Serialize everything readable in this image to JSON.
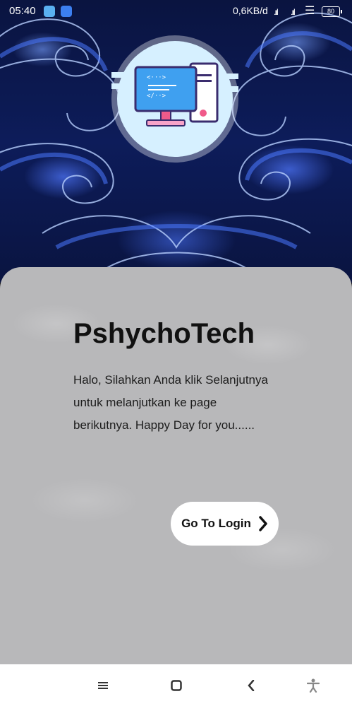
{
  "status_bar": {
    "time": "05:40",
    "network_speed": "0,6KB/d",
    "signal1": ".ııl",
    "signal2": ".ııl",
    "wifi": "wifi-icon",
    "battery": "80"
  },
  "hero": {
    "logo_icon": "computer-desktop-icon"
  },
  "card": {
    "title": "PshychoTech",
    "description_lines": [
      "Halo, Silahkan Anda klik Selanjutnya",
      "untuk melanjutkan ke page",
      "berikutnya. Happy Day for you......"
    ],
    "login_button": "Go To Login"
  },
  "navbar": {
    "menu": "menu-icon",
    "home": "home-icon",
    "back": "back-icon",
    "accessibility": "accessibility-icon"
  },
  "colors": {
    "card_bg": "#b8b8ba",
    "hero_bg": "#0d1c5a",
    "button_bg": "#ffffff"
  }
}
